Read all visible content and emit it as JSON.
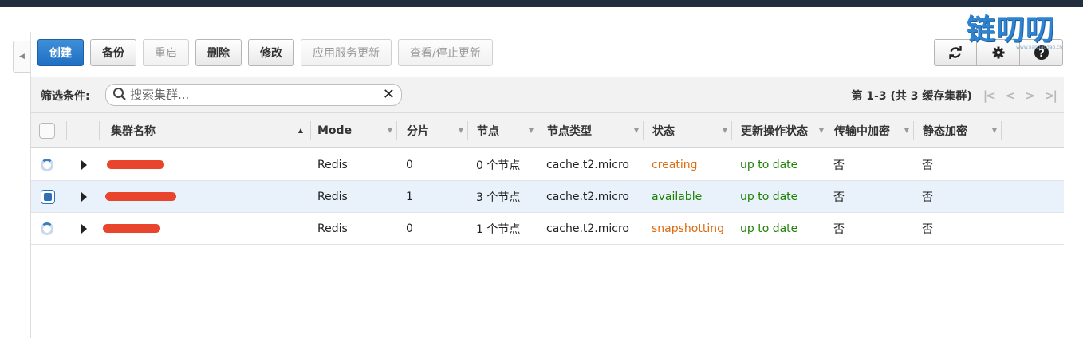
{
  "toolbar": {
    "create": "创建",
    "backup": "备份",
    "restart": "重启",
    "delete": "删除",
    "modify": "修改",
    "apply_update": "应用服务更新",
    "view_stop_update": "查看/停止更新"
  },
  "icons": {
    "refresh": "refresh-icon",
    "settings": "gear-icon",
    "help": "help-icon",
    "collapse": "chevron-left-icon"
  },
  "watermark": {
    "text": "链叨叨",
    "url": "www.liandaodao.cn"
  },
  "filter": {
    "label": "筛选条件:",
    "placeholder": "搜索集群...",
    "value": ""
  },
  "pagination": {
    "info": "第 1-3 (共 3 缓存集群)",
    "first": "|<",
    "prev": "<",
    "next": ">",
    "last": ">|"
  },
  "table": {
    "headers": [
      "集群名称",
      "Mode",
      "分片",
      "节点",
      "节点类型",
      "状态",
      "更新操作状态",
      "传输中加密",
      "静态加密"
    ],
    "rows": [
      {
        "mode": "Redis",
        "shards": "0",
        "nodes": "0 个节点",
        "node_type": "cache.t2.micro",
        "status": "creating",
        "update_status": "up to date",
        "transit": "否",
        "rest": "否",
        "icon": "loading-icon"
      },
      {
        "mode": "Redis",
        "shards": "1",
        "nodes": "3 个节点",
        "node_type": "cache.t2.micro",
        "status": "available",
        "update_status": "up to date",
        "transit": "否",
        "rest": "否",
        "icon": "checkbox"
      },
      {
        "mode": "Redis",
        "shards": "0",
        "nodes": "1 个节点",
        "node_type": "cache.t2.micro",
        "status": "snapshotting",
        "update_status": "up to date",
        "transit": "否",
        "rest": "否",
        "icon": "loading-icon"
      }
    ]
  },
  "colors": {
    "primary": "#1f6fc4",
    "status_orange": "#dd6b10",
    "status_green": "#1d8102",
    "redaction": "#e8452c"
  }
}
